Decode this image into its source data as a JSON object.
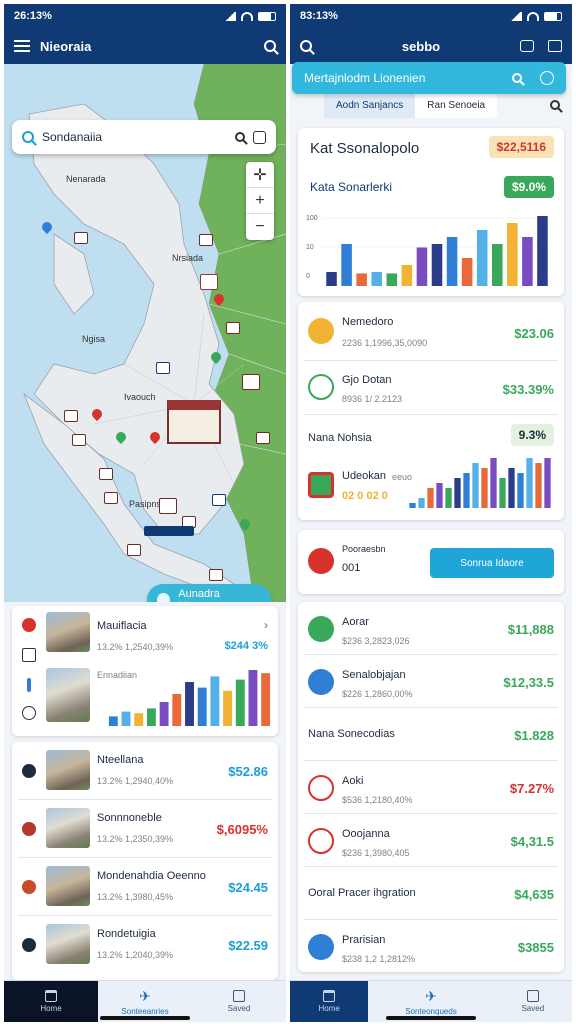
{
  "left": {
    "status": {
      "time": "26:13%"
    },
    "appbar": {
      "title": "Nieoraia"
    },
    "search": {
      "value": "Sondanaiia"
    },
    "map": {
      "labels": [
        "Nenarada",
        "Nrsiada",
        "Ngisa",
        "Ivaouch",
        "Pasipns"
      ],
      "cta_label": "Aunadra Mernons"
    },
    "summary_card": {
      "title": "Mauiflacia",
      "subtitle": "13.2% 1,2540,39%",
      "price": "$244 3%",
      "chart_label": "Ennadiian",
      "chart_values": [
        12,
        18,
        16,
        22,
        30,
        40,
        55,
        48,
        62,
        44,
        58,
        70,
        66
      ],
      "colors": [
        "#2f7fd6",
        "#53b1e8",
        "#f2b233",
        "#3aa85a",
        "#7a4cc2",
        "#e86a3a",
        "#2b3c88"
      ]
    },
    "listings": [
      {
        "title": "Nteellana",
        "subtitle": "13.2% 1,2940,40%",
        "price": "$52.86",
        "price_color": "#1b9fd6",
        "icon_color": "#1d2b3d"
      },
      {
        "title": "Sonnnoneble",
        "subtitle": "13.2% 1,2350,39%",
        "price": "$,6095%",
        "price_color": "#d8322d",
        "icon_color": "#b7352b"
      },
      {
        "title": "Mondenahdia Oeenno",
        "subtitle": "13.2% 1,3980,45%",
        "price": "$24.45",
        "price_color": "#1b9fd6",
        "icon_color": "#c84a2a"
      },
      {
        "title": "Rondetuigia",
        "subtitle": "13.2% 1,2040,39%",
        "price": "$22.59",
        "price_color": "#1b9fd6",
        "icon_color": "#1d2b3d"
      }
    ],
    "nav": {
      "items": [
        "Home",
        "Sonteeanries",
        "Saved"
      ]
    }
  },
  "right": {
    "status": {
      "time": "83:13%"
    },
    "appbar": {
      "title": "sebbo"
    },
    "chip": {
      "label": "Mertajnlodm Lionenien"
    },
    "tabs": [
      "Aodn Sanjancs",
      "Ran Senoeia"
    ],
    "chart_card": {
      "title": "Kat Ssonalopolo",
      "badge": "$22,5116",
      "badge_bg": "#f9e3b4",
      "badge_color": "#d8322d",
      "sub_title": "Kata Sonarlerki",
      "sub_badge": "$9.0%",
      "sub_badge_bg": "#3aa85a",
      "ticks": [
        "100",
        "10",
        "0"
      ],
      "values": [
        20,
        60,
        18,
        20,
        18,
        30,
        55,
        60,
        70,
        40,
        80,
        60,
        90,
        70,
        100
      ],
      "colors": [
        "#2b3c88",
        "#2f7fd6",
        "#e86a3a",
        "#53b1e8",
        "#3aa85a",
        "#f2b233",
        "#7a4cc2"
      ]
    },
    "stats_card": {
      "rows": [
        {
          "title": "Nemedoro",
          "subtitle": "2236 1,1996,35,0090",
          "value": "$23.06",
          "icon_color": "#f2b233"
        },
        {
          "title": "Gjo Dotan",
          "subtitle": "8936 1/ 2.2123",
          "value": "$33.39%",
          "icon_color": "#3aa85a"
        }
      ],
      "third_title": "Nana Nohsia",
      "third_badge": "9.3%",
      "fourth_title": "Udeokan",
      "fourth_sub": "eeuo",
      "fourth_nums": "02 0 02 0",
      "values": [
        10,
        20,
        40,
        50,
        40,
        60,
        70,
        90,
        80,
        100,
        60,
        80,
        70,
        100,
        90,
        100
      ],
      "colors": [
        "#2f7fd6",
        "#53b1e8",
        "#e86a3a",
        "#7a4cc2",
        "#3aa85a",
        "#2b3c88"
      ]
    },
    "action_card": {
      "title": "Pooraesbn",
      "value": "001",
      "button": "Sonrua Idaore"
    },
    "list": [
      {
        "title": "Aorar",
        "subtitle": "$236 3,2823,026",
        "value": "$11,888",
        "icon_color": "#3aa85a",
        "value_color": "#3aa85a"
      },
      {
        "title": "Senalobjajan",
        "subtitle": "$226 1,2860,00%",
        "value": "$12,33.5",
        "icon_color": "#2f7fd6",
        "value_color": "#3aa85a"
      },
      {
        "title": "Nana Sonecodias",
        "subtitle": "",
        "value": "$1.828",
        "icon_color": "",
        "value_color": "#3aa85a"
      },
      {
        "title": "Aoki",
        "subtitle": "$536 1,2180,40%",
        "value": "$7.27%",
        "icon_color": "#d8322d",
        "value_color": "#d8322d"
      },
      {
        "title": "Ooojanna",
        "subtitle": "$236 1,3980,405",
        "value": "$4,31.5",
        "icon_color": "#d8322d",
        "value_color": "#3aa85a"
      },
      {
        "title": "Ooral Pracer ihgration",
        "subtitle": "",
        "value": "$4,635",
        "icon_color": "",
        "value_color": "#3aa85a"
      },
      {
        "title": "Prarisian",
        "subtitle": "$238 1,2 1,2812%",
        "value": "$3855",
        "icon_color": "#2f7fd6",
        "value_color": "#3aa85a"
      }
    ],
    "nav": {
      "items": [
        "Home",
        "Sonteonqueds",
        "Saved"
      ]
    }
  }
}
